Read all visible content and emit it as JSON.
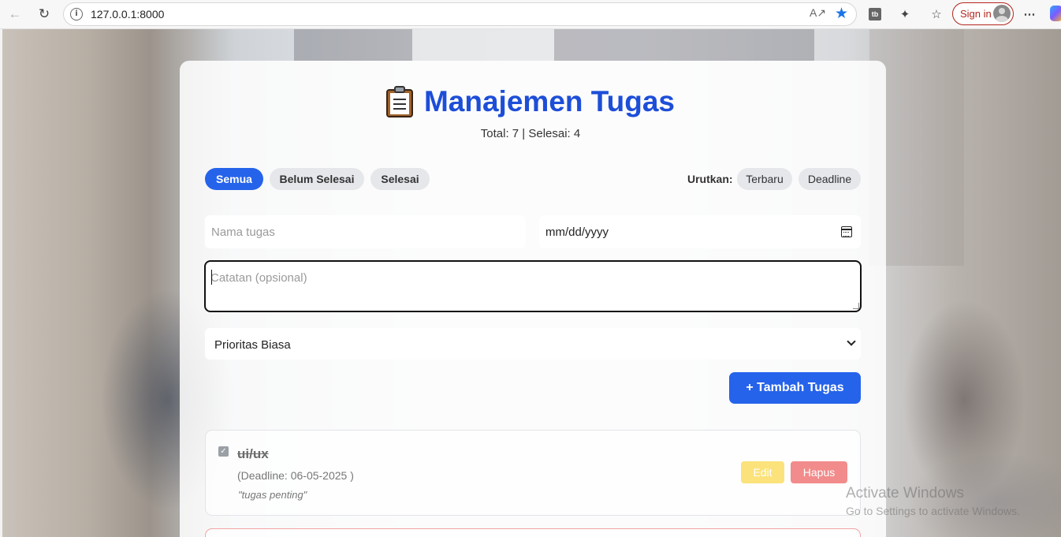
{
  "browser": {
    "url": "127.0.0.1:8000",
    "sign_in_label": "Sign in"
  },
  "app": {
    "title": "Manajemen Tugas",
    "stats": "Total: 7 | Selesai: 4"
  },
  "filters": {
    "all": "Semua",
    "pending": "Belum Selesai",
    "done": "Selesai",
    "active": "Semua"
  },
  "sort": {
    "label": "Urutkan:",
    "newest": "Terbaru",
    "deadline": "Deadline"
  },
  "form": {
    "task_name_placeholder": "Nama tugas",
    "date_placeholder": "mm/dd/yyyy",
    "notes_placeholder": "Catatan (opsional)",
    "priority_selected": "Prioritas Biasa",
    "add_button": "+ Tambah Tugas"
  },
  "tasks": [
    {
      "title": "ui/ux",
      "deadline": "(Deadline: 06-05-2025 )",
      "note": "\"tugas penting\"",
      "completed": true,
      "edit_label": "Edit",
      "delete_label": "Hapus"
    }
  ],
  "watermark": {
    "title": "Activate Windows",
    "subtitle": "Go to Settings to activate Windows."
  },
  "colors": {
    "primary": "#2563eb",
    "title": "#1d4ed8",
    "edit": "#fbe27a",
    "delete": "#f28b8b"
  }
}
